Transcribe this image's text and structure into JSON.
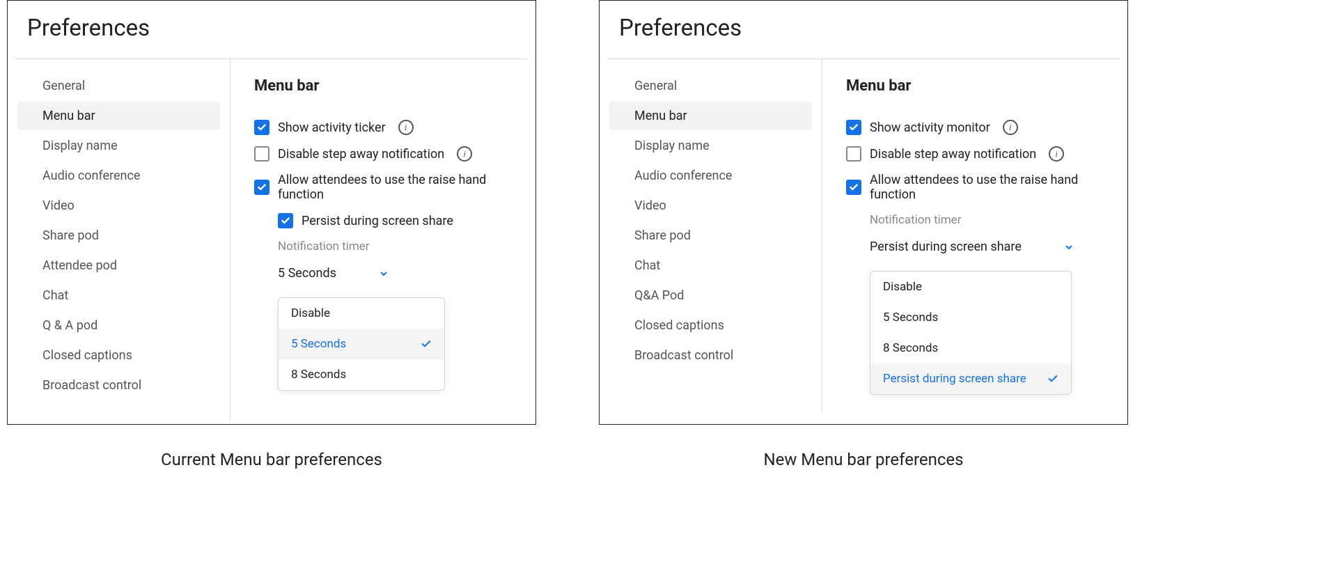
{
  "left": {
    "panel_title": "Preferences",
    "section_title": "Menu bar",
    "sidebar": {
      "items": [
        {
          "label": "General",
          "slug": "general",
          "selected": false
        },
        {
          "label": "Menu bar",
          "slug": "menu-bar",
          "selected": true
        },
        {
          "label": "Display name",
          "slug": "display-name",
          "selected": false
        },
        {
          "label": "Audio conference",
          "slug": "audio-conference",
          "selected": false
        },
        {
          "label": "Video",
          "slug": "video",
          "selected": false
        },
        {
          "label": "Share pod",
          "slug": "share-pod",
          "selected": false
        },
        {
          "label": "Attendee pod",
          "slug": "attendee-pod",
          "selected": false
        },
        {
          "label": "Chat",
          "slug": "chat",
          "selected": false
        },
        {
          "label": "Q & A pod",
          "slug": "qa-pod",
          "selected": false
        },
        {
          "label": "Closed captions",
          "slug": "closed-captions",
          "selected": false
        },
        {
          "label": "Broadcast control",
          "slug": "broadcast-control",
          "selected": false
        }
      ]
    },
    "options": {
      "show_activity_label": "Show activity ticker",
      "show_activity_checked": true,
      "disable_step_away_label": "Disable step away notification",
      "disable_step_away_checked": false,
      "allow_raise_hand_label": "Allow attendees to use the raise hand function",
      "allow_raise_hand_checked": true,
      "persist_label": "Persist during screen share",
      "persist_checked": true,
      "notif_timer_label": "Notification timer",
      "notif_timer_value": "5 Seconds",
      "notif_timer_menu": [
        {
          "label": "Disable",
          "selected": false
        },
        {
          "label": "5 Seconds",
          "selected": true
        },
        {
          "label": "8 Seconds",
          "selected": false
        }
      ]
    },
    "caption": "Current Menu bar preferences"
  },
  "right": {
    "panel_title": "Preferences",
    "section_title": "Menu bar",
    "sidebar": {
      "items": [
        {
          "label": "General",
          "slug": "general",
          "selected": false
        },
        {
          "label": "Menu bar",
          "slug": "menu-bar",
          "selected": true
        },
        {
          "label": "Display name",
          "slug": "display-name",
          "selected": false
        },
        {
          "label": "Audio conference",
          "slug": "audio-conference",
          "selected": false
        },
        {
          "label": "Video",
          "slug": "video",
          "selected": false
        },
        {
          "label": "Share pod",
          "slug": "share-pod",
          "selected": false
        },
        {
          "label": "Chat",
          "slug": "chat",
          "selected": false
        },
        {
          "label": "Q&A Pod",
          "slug": "qa-pod",
          "selected": false
        },
        {
          "label": "Closed captions",
          "slug": "closed-captions",
          "selected": false
        },
        {
          "label": "Broadcast control",
          "slug": "broadcast-control",
          "selected": false
        }
      ]
    },
    "options": {
      "show_activity_label": "Show activity monitor",
      "show_activity_checked": true,
      "disable_step_away_label": "Disable step away notification",
      "disable_step_away_checked": false,
      "allow_raise_hand_label": "Allow attendees to use the raise hand function",
      "allow_raise_hand_checked": true,
      "notif_timer_label": "Notification timer",
      "notif_timer_value": "Persist during screen share",
      "notif_timer_menu": [
        {
          "label": "Disable",
          "selected": false
        },
        {
          "label": "5 Seconds",
          "selected": false
        },
        {
          "label": "8 Seconds",
          "selected": false
        },
        {
          "label": "Persist during screen share",
          "selected": true
        }
      ]
    },
    "caption": "New Menu bar preferences"
  }
}
